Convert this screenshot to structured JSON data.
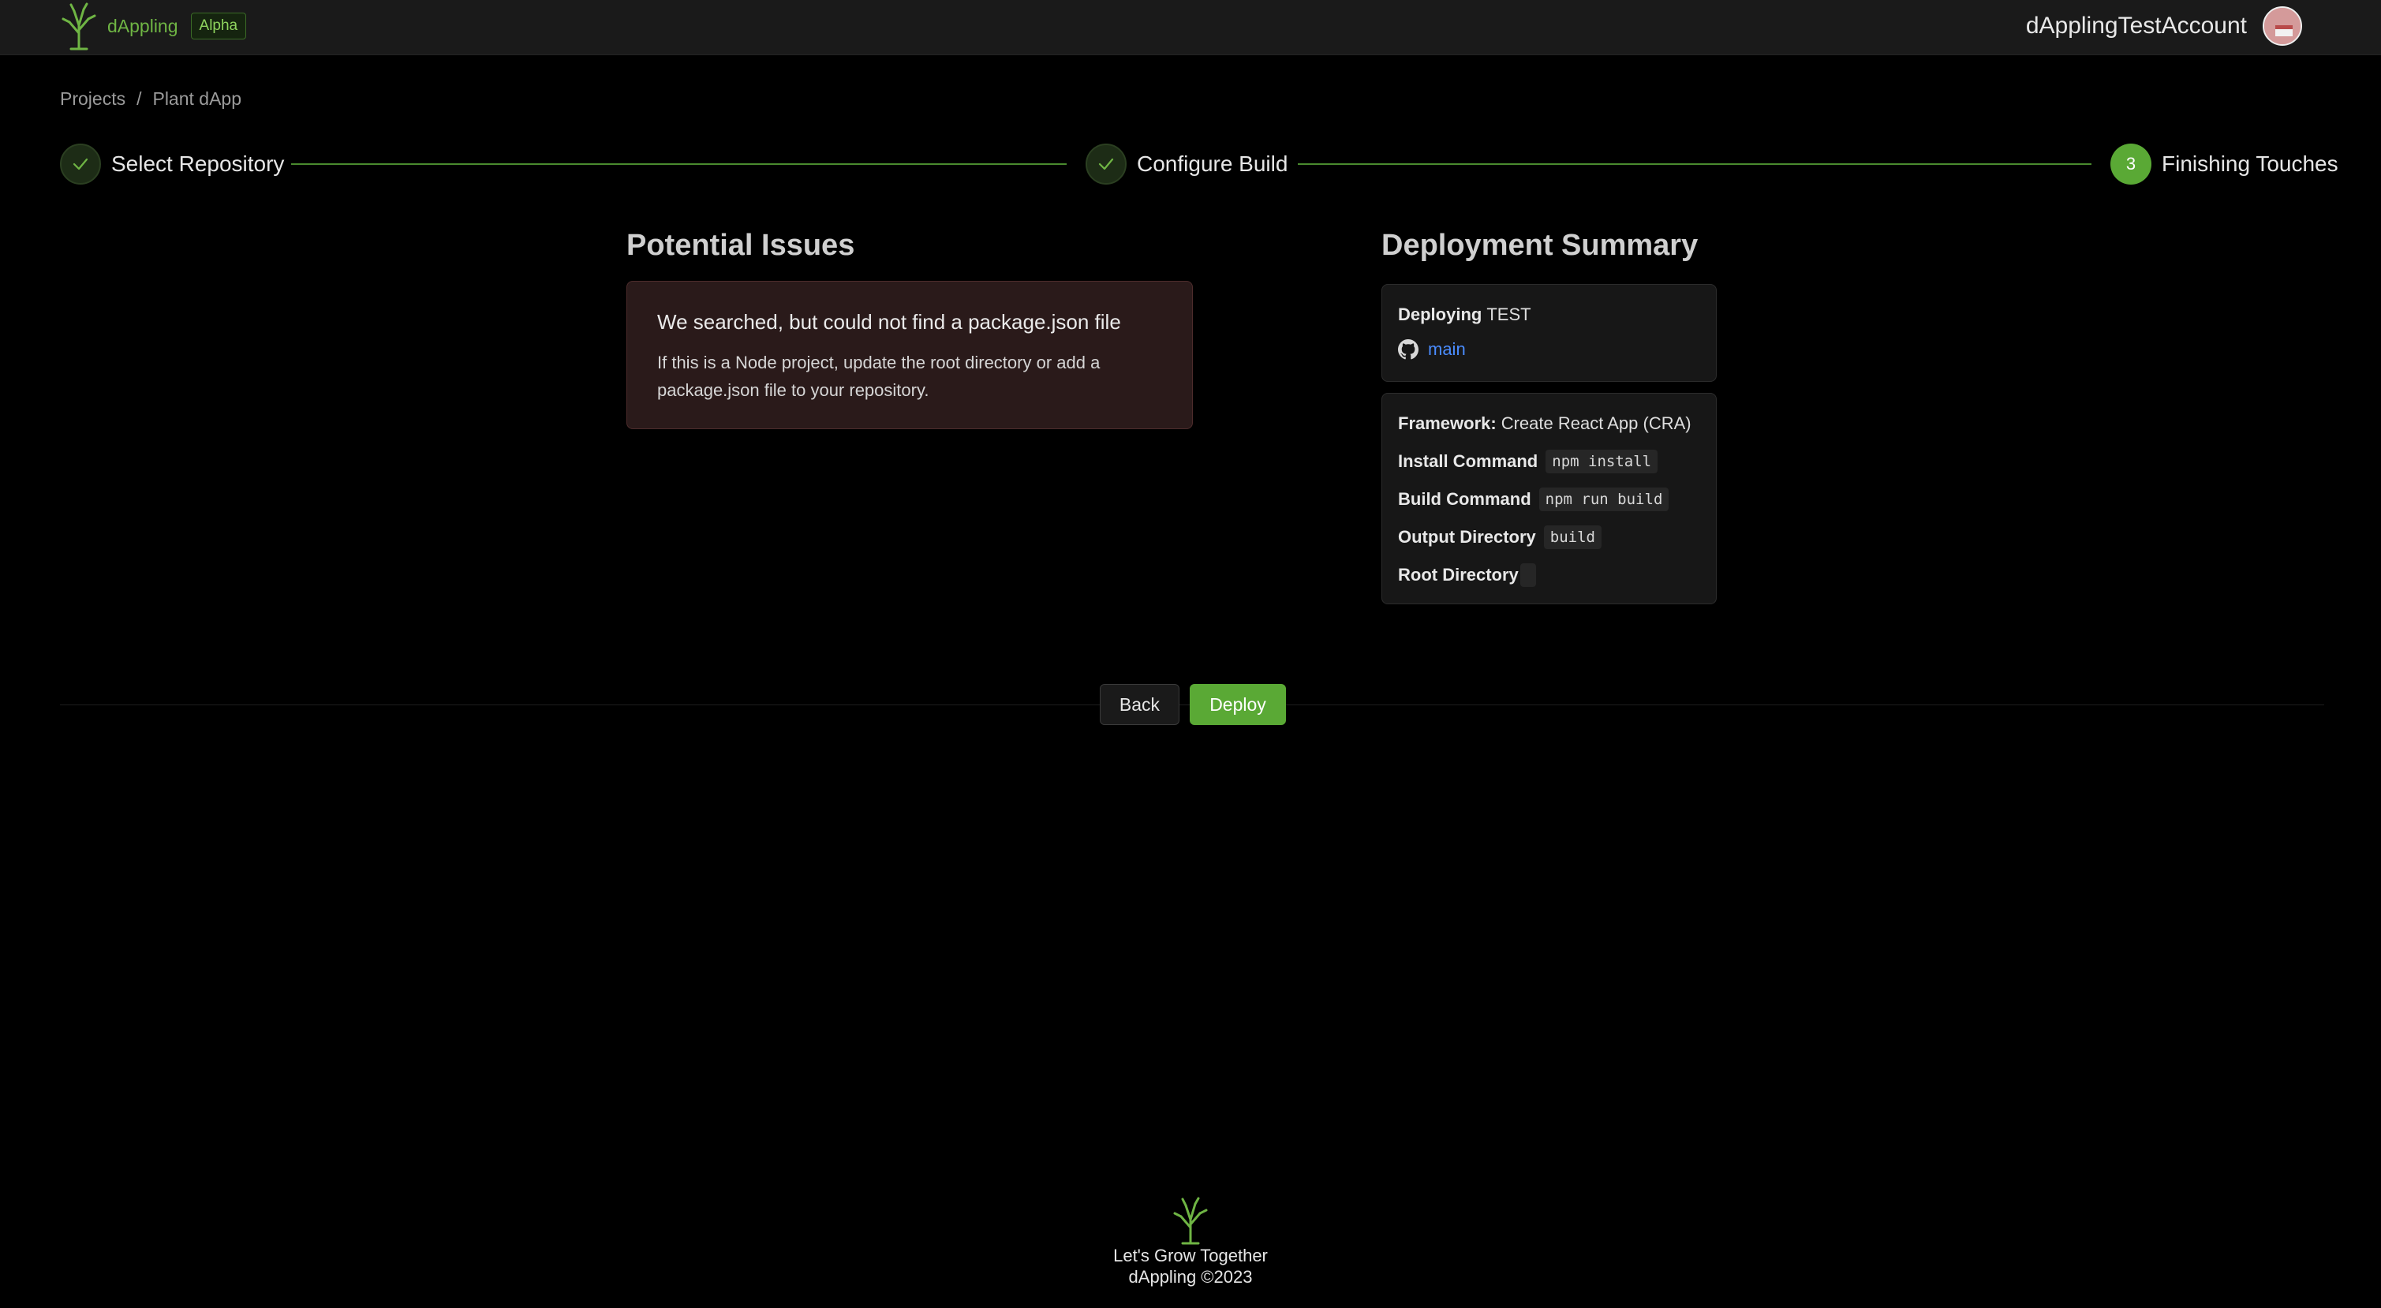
{
  "app": {
    "brand_name": "dAppling",
    "badge": "Alpha",
    "account_name": "dApplingTestAccount"
  },
  "breadcrumb": {
    "items": [
      "Projects",
      "Plant dApp"
    ],
    "separator": "/"
  },
  "stepper": {
    "steps": [
      {
        "label": "Select Repository",
        "status": "done"
      },
      {
        "label": "Configure Build",
        "status": "done"
      },
      {
        "label": "Finishing Touches",
        "status": "active",
        "number": "3"
      }
    ]
  },
  "issues": {
    "heading": "Potential Issues",
    "title": "We searched, but could not find a package.json file",
    "description": "If this is a Node project, update the root directory or add a package.json file to your repository."
  },
  "summary": {
    "heading": "Deployment Summary",
    "deploying_label": "Deploying",
    "deploying_value": "TEST",
    "branch": "main",
    "framework_label": "Framework:",
    "framework_value": "Create React App (CRA)",
    "install_label": "Install Command",
    "install_value": "npm install",
    "build_label": "Build Command",
    "build_value": "npm run build",
    "output_label": "Output Directory",
    "output_value": "build",
    "root_label": "Root Directory",
    "root_value": ""
  },
  "actions": {
    "back_label": "Back",
    "deploy_label": "Deploy"
  },
  "footer": {
    "tagline": "Let's Grow Together",
    "copyright": "dAppling ©2023"
  },
  "colors": {
    "accent": "#5aa935",
    "link": "#4a8cff",
    "issue_bg": "#2a1a1a"
  }
}
